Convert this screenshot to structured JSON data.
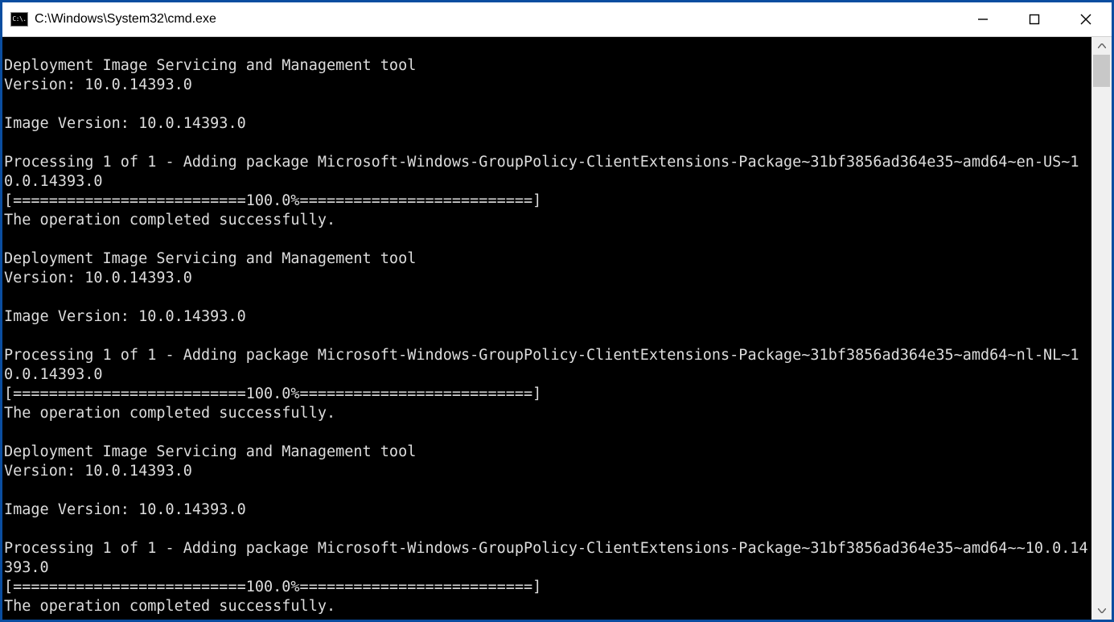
{
  "window": {
    "title": "C:\\Windows\\System32\\cmd.exe",
    "icon_label": "C:\\."
  },
  "console": {
    "lines": [
      "",
      "Deployment Image Servicing and Management tool",
      "Version: 10.0.14393.0",
      "",
      "Image Version: 10.0.14393.0",
      "",
      "Processing 1 of 1 - Adding package Microsoft-Windows-GroupPolicy-ClientExtensions-Package~31bf3856ad364e35~amd64~en-US~10.0.14393.0",
      "[==========================100.0%==========================]",
      "The operation completed successfully.",
      "",
      "Deployment Image Servicing and Management tool",
      "Version: 10.0.14393.0",
      "",
      "Image Version: 10.0.14393.0",
      "",
      "Processing 1 of 1 - Adding package Microsoft-Windows-GroupPolicy-ClientExtensions-Package~31bf3856ad364e35~amd64~nl-NL~10.0.14393.0",
      "[==========================100.0%==========================]",
      "The operation completed successfully.",
      "",
      "Deployment Image Servicing and Management tool",
      "Version: 10.0.14393.0",
      "",
      "Image Version: 10.0.14393.0",
      "",
      "Processing 1 of 1 - Adding package Microsoft-Windows-GroupPolicy-ClientExtensions-Package~31bf3856ad364e35~amd64~~10.0.14393.0",
      "[==========================100.0%==========================]",
      "The operation completed successfully."
    ]
  }
}
